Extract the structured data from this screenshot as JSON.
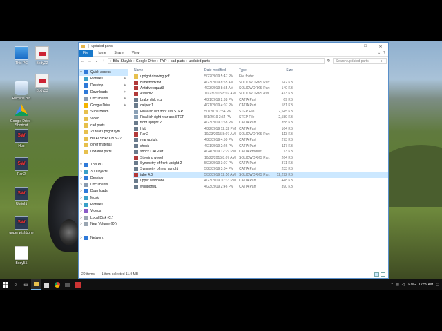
{
  "desktop": {
    "icons": [
      {
        "label": "This PC",
        "kind": "pc"
      },
      {
        "label": "Body22",
        "kind": "pdf"
      },
      {
        "label": "Recycle Bin",
        "kind": "bin"
      },
      {
        "label": "Body33",
        "kind": "pdf"
      },
      {
        "label": "Google Drive - Shortcut",
        "kind": "drive"
      },
      {
        "label": "Hub",
        "kind": "sw"
      },
      {
        "label": "Part2",
        "kind": "sw"
      },
      {
        "label": "Upright",
        "kind": "sw"
      },
      {
        "label": "upper wishbone",
        "kind": "sw"
      },
      {
        "label": "Body55",
        "kind": "blank"
      }
    ]
  },
  "window": {
    "title": "updated parts",
    "ribbon_tabs": [
      "File",
      "Home",
      "Share",
      "View"
    ],
    "address_crumbs": [
      "Bilal Shaykh",
      "Google Drive",
      "FYP",
      "cad parts",
      "updated parts"
    ],
    "search_placeholder": "Search updated parts",
    "columns": {
      "name": "Name",
      "date": "Date modified",
      "type": "Type",
      "size": "Size"
    },
    "nav": [
      {
        "label": "Quick access",
        "chev": "v",
        "icon": "#2f7ad9",
        "pin": "",
        "sel": true
      },
      {
        "label": "Pictures",
        "chev": "",
        "icon": "#3aa0c8",
        "pin": "✦",
        "sel": false
      },
      {
        "label": "Desktop",
        "chev": "",
        "icon": "#2f7ad9",
        "pin": "✦",
        "sel": false
      },
      {
        "label": "Downloads",
        "chev": "",
        "icon": "#2f7ad9",
        "pin": "✦",
        "sel": false
      },
      {
        "label": "Documents",
        "chev": "",
        "icon": "#8a9bb0",
        "pin": "✦",
        "sel": false
      },
      {
        "label": "Google Drive",
        "chev": "",
        "icon": "#f4b400",
        "pin": "✦",
        "sel": false
      },
      {
        "label": "SuperBeam",
        "chev": "",
        "icon": "#e7c04d",
        "pin": "",
        "sel": false
      },
      {
        "label": "Video",
        "chev": "",
        "icon": "#e7c04d",
        "pin": "",
        "sel": false
      },
      {
        "label": "cad parts",
        "chev": "",
        "icon": "#e7c04d",
        "pin": "",
        "sel": false
      },
      {
        "label": "2x rear upright sym",
        "chev": "",
        "icon": "#e7c04d",
        "pin": "",
        "sel": false
      },
      {
        "label": "BILALSHAYKH 5-27",
        "chev": "",
        "icon": "#e7c04d",
        "pin": "",
        "sel": false
      },
      {
        "label": "other material",
        "chev": "",
        "icon": "#e7c04d",
        "pin": "",
        "sel": false
      },
      {
        "label": "updated parts",
        "chev": "",
        "icon": "#e7c04d",
        "pin": "",
        "sel": false
      },
      {
        "label": "",
        "chev": "",
        "icon": "",
        "pin": "",
        "sel": false
      },
      {
        "label": "This PC",
        "chev": "v",
        "icon": "#2f7ad9",
        "pin": "",
        "sel": false
      },
      {
        "label": "3D Objects",
        "chev": ">",
        "icon": "#3aa0c8",
        "pin": "",
        "sel": false
      },
      {
        "label": "Desktop",
        "chev": ">",
        "icon": "#2f7ad9",
        "pin": "",
        "sel": false
      },
      {
        "label": "Documents",
        "chev": ">",
        "icon": "#8a9bb0",
        "pin": "",
        "sel": false
      },
      {
        "label": "Downloads",
        "chev": ">",
        "icon": "#2f7ad9",
        "pin": "",
        "sel": false
      },
      {
        "label": "Music",
        "chev": ">",
        "icon": "#3aa0c8",
        "pin": "",
        "sel": false
      },
      {
        "label": "Pictures",
        "chev": ">",
        "icon": "#3aa0c8",
        "pin": "",
        "sel": false
      },
      {
        "label": "Videos",
        "chev": ">",
        "icon": "#8a5bc8",
        "pin": "",
        "sel": false
      },
      {
        "label": "Local Disk (C:)",
        "chev": ">",
        "icon": "#9aa6b2",
        "pin": "",
        "sel": false
      },
      {
        "label": "New Volume (D:)",
        "chev": ">",
        "icon": "#9aa6b2",
        "pin": "",
        "sel": false
      },
      {
        "label": "",
        "chev": "",
        "icon": "",
        "pin": "",
        "sel": false
      },
      {
        "label": "Network",
        "chev": ">",
        "icon": "#2f7ad9",
        "pin": "",
        "sel": false
      }
    ],
    "files": [
      {
        "name": "upright drawing.pdf",
        "date": "5/22/2019 5:47 PM",
        "type": "File folder",
        "size": "",
        "icon": "#e7c04d",
        "sel": false
      },
      {
        "name": "Bimetbodkind",
        "date": "4/23/2019 8:55 AM",
        "type": "SOLIDWORKS Part",
        "size": "142 KB",
        "icon": "#b23a3a",
        "sel": false
      },
      {
        "name": "Antidive squat3",
        "date": "4/23/2019 8:55 AM",
        "type": "SOLIDWORKS Part",
        "size": "140 KB",
        "icon": "#b23a3a",
        "sel": false
      },
      {
        "name": "Assem2",
        "date": "10/23/2015 8:07 AM",
        "type": "SOLIDWORKS Ass...",
        "size": "413 KB",
        "icon": "#b23a3a",
        "sel": false
      },
      {
        "name": "brake disk e.g",
        "date": "4/21/2019 2:38 PM",
        "type": "CATIA Part",
        "size": "69 KB",
        "icon": "#6a7b8c",
        "sel": false
      },
      {
        "name": "caliper 1",
        "date": "4/21/2019 4:07 PM",
        "type": "CATIA Part",
        "size": "181 KB",
        "icon": "#6a7b8c",
        "sel": false
      },
      {
        "name": "Final-ish left front ass.STEP",
        "date": "5/1/2019 2:54 PM",
        "type": "STEP File",
        "size": "2,545 KB",
        "icon": "#8aa0b5",
        "sel": false
      },
      {
        "name": "Final-ish right rear ass.STEP",
        "date": "5/1/2019 2:54 PM",
        "type": "STEP File",
        "size": "2,589 KB",
        "icon": "#8aa0b5",
        "sel": false
      },
      {
        "name": "front upright 2",
        "date": "4/23/2019 3:58 PM",
        "type": "CATIA Part",
        "size": "358 KB",
        "icon": "#6a7b8c",
        "sel": false
      },
      {
        "name": "Hub",
        "date": "4/22/2019 12:32 PM",
        "type": "CATIA Part",
        "size": "164 KB",
        "icon": "#6a7b8c",
        "sel": false
      },
      {
        "name": "Part2",
        "date": "10/23/2015 8:07 AM",
        "type": "SOLIDWORKS Part",
        "size": "113 KB",
        "icon": "#b23a3a",
        "sel": false
      },
      {
        "name": "rear upright",
        "date": "4/23/2019 4:50 PM",
        "type": "CATIA Part",
        "size": "273 KB",
        "icon": "#6a7b8c",
        "sel": false
      },
      {
        "name": "shock",
        "date": "4/21/2019 2:26 PM",
        "type": "CATIA Part",
        "size": "117 KB",
        "icon": "#6a7b8c",
        "sel": false
      },
      {
        "name": "shock.CATPart",
        "date": "4/24/2019 12:29 PM",
        "type": "CATIA Product",
        "size": "13 KB",
        "icon": "#6a7b8c",
        "sel": false
      },
      {
        "name": "Steering wheel",
        "date": "10/23/2015 8:07 AM",
        "type": "SOLIDWORKS Part",
        "size": "264 KB",
        "icon": "#b23a3a",
        "sel": false
      },
      {
        "name": "Symmetry of front upright 2",
        "date": "5/23/2019 3:07 PM",
        "type": "CATIA Part",
        "size": "371 KB",
        "icon": "#6a7b8c",
        "sel": false
      },
      {
        "name": "Symmetry of rear upright",
        "date": "5/23/2019 3:04 PM",
        "type": "CATIA Part",
        "size": "233 KB",
        "icon": "#6a7b8c",
        "sel": false
      },
      {
        "name": "tube 4.0",
        "date": "5/30/2019 12:56 AM",
        "type": "SOLIDWORKS Part",
        "size": "12,292 KB",
        "icon": "#b23a3a",
        "sel": true
      },
      {
        "name": "upper wishbone",
        "date": "4/23/2019 10:33 PM",
        "type": "CATIA Part",
        "size": "448 KB",
        "icon": "#6a7b8c",
        "sel": false
      },
      {
        "name": "wishbone1",
        "date": "4/23/2019 2:46 PM",
        "type": "CATIA Part",
        "size": "390 KB",
        "icon": "#6a7b8c",
        "sel": false
      }
    ],
    "status": {
      "count": "20 items",
      "selection": "1 item selected  11.9 MB"
    }
  },
  "taskbar": {
    "lang": "ENG",
    "clock": "12:59 AM"
  }
}
